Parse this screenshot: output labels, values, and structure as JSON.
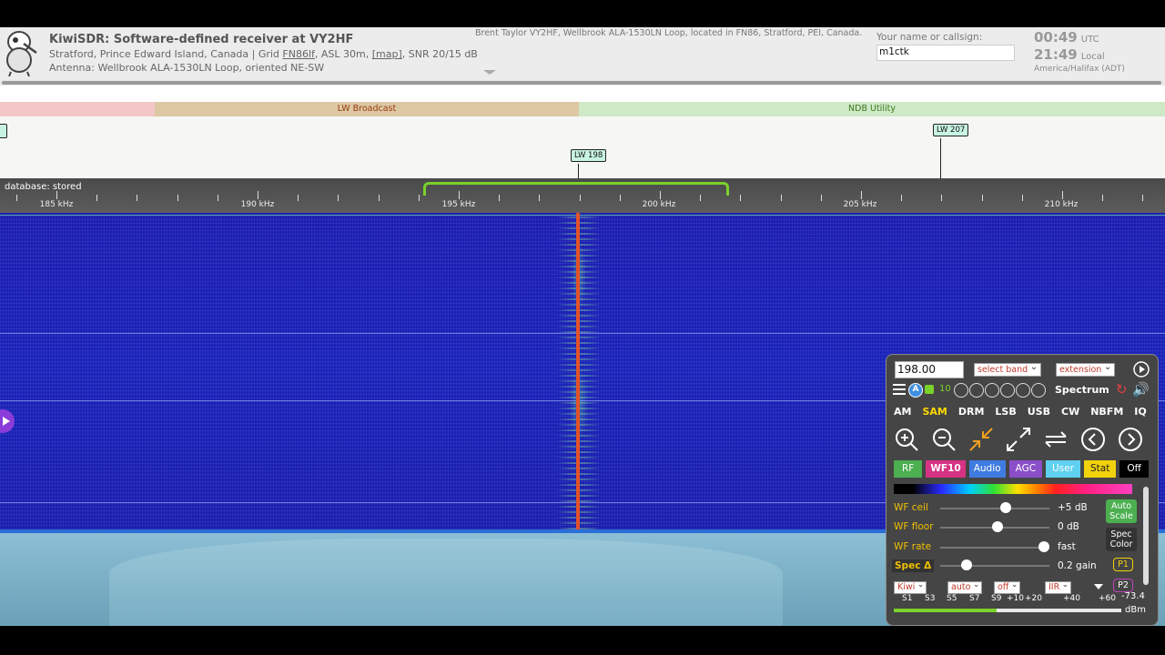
{
  "header": {
    "title": "KiwiSDR: Software-defined receiver at VY2HF",
    "location_pre": "Stratford, Prince Edward Island, Canada | Grid ",
    "grid": "FN86lf",
    "location_mid": ", ASL 30m, ",
    "map_link": "[map]",
    "location_post": ", SNR 20/15 dB",
    "antenna": "Antenna: Wellbrook ALA-1530LN Loop, oriented NE-SW",
    "owner": "Brent Taylor VY2HF, Wellbrook ALA-1530LN Loop, located in FN86, Stratford, PEI, Canada.",
    "name_label": "Your name or callsign:",
    "name_value": "m1ctk",
    "utc_time": "00:49",
    "utc_label": "UTC",
    "local_time": "21:49",
    "local_label": "Local",
    "timezone": "America/Halifax (ADT)"
  },
  "bands": {
    "lw_broadcast": "LW Broadcast",
    "ndb_utility": "NDB Utility"
  },
  "stations": [
    "LW 198",
    "LW 207"
  ],
  "scale": {
    "database": "database: stored",
    "freqs": [
      "185 kHz",
      "190 kHz",
      "195 kHz",
      "200 kHz",
      "205 kHz",
      "210 kHz"
    ]
  },
  "panel": {
    "frequency": "198.00",
    "select_band": "select band",
    "extension": "extension",
    "step": "10",
    "spectrum": "Spectrum",
    "modes": [
      "AM",
      "SAM",
      "DRM",
      "LSB",
      "USB",
      "CW",
      "NBFM",
      "IQ"
    ],
    "active_mode": "SAM",
    "tabs": [
      "RF",
      "WF10",
      "Audio",
      "AGC",
      "User",
      "Stat",
      "Off"
    ],
    "sliders": [
      {
        "label": "WF ceil",
        "value": "+5 dB",
        "level": 0.58
      },
      {
        "label": "WF floor",
        "value": "0 dB",
        "level": 0.5
      },
      {
        "label": "WF rate",
        "value": "fast",
        "level": 0.95
      },
      {
        "label": "Spec Δ",
        "value": "0.2 gain",
        "level": 0.2
      }
    ],
    "auto_scale": "Auto Scale",
    "spec_color": "Spec Color",
    "p1": "P1",
    "p2": "P2",
    "bottom_selects": [
      "Kiwi",
      "auto",
      "off",
      "IIR"
    ],
    "smeter_labels": [
      "S1",
      "S3",
      "S5",
      "S7",
      "S9",
      "+10",
      "+20",
      "+40",
      "+60"
    ],
    "dbm_value": "-73.4",
    "dbm_unit": "dBm",
    "signal_level": 0.45
  },
  "colors": {
    "accent_green": "#7ad22a",
    "waterfall_blue": "#1c1cb0",
    "carrier": "#e0522a",
    "tab_rf": "#4caf50",
    "tab_wf": "#d63384",
    "tab_audio": "#3f7be0",
    "tab_agc": "#8a4fc8",
    "tab_user": "#5fd0f0",
    "tab_stat": "#f2d20c",
    "tab_off": "#000000"
  }
}
